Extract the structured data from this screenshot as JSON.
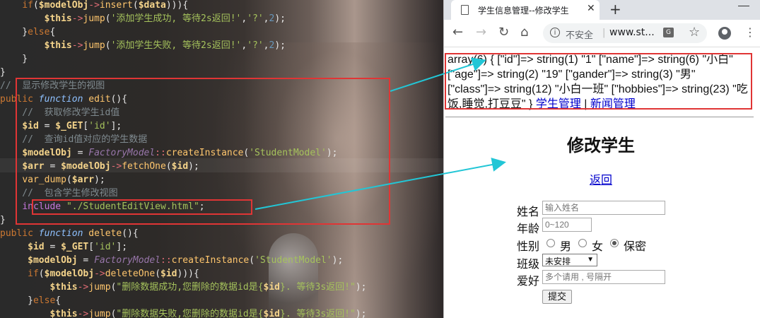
{
  "editor": {
    "lines": [
      {
        "segments": [
          [
            "t-pl",
            "    "
          ],
          [
            "t-kw",
            "if"
          ],
          [
            "t-pl",
            "("
          ],
          [
            "t-var",
            "$modelObj"
          ],
          [
            "t-op",
            "->"
          ],
          [
            "t-fn",
            "insert"
          ],
          [
            "t-pl",
            "("
          ],
          [
            "t-var",
            "$data"
          ],
          [
            "t-pl",
            "))){"
          ]
        ]
      },
      {
        "segments": [
          [
            "t-pl",
            "        "
          ],
          [
            "t-var",
            "$this"
          ],
          [
            "t-op",
            "->"
          ],
          [
            "t-fn",
            "jump"
          ],
          [
            "t-pl",
            "("
          ],
          [
            "t-str",
            "'添加学生成功, 等待2s返回!'"
          ],
          [
            "t-pl",
            ","
          ],
          [
            "t-str",
            "'?'"
          ],
          [
            "t-pl",
            ","
          ],
          [
            "t-num",
            "2"
          ],
          [
            "t-pl",
            ");"
          ]
        ]
      },
      {
        "segments": [
          [
            "t-pl",
            "    }"
          ],
          [
            "t-kw",
            "else"
          ],
          [
            "t-pl",
            "{"
          ]
        ]
      },
      {
        "segments": [
          [
            "t-pl",
            "        "
          ],
          [
            "t-var",
            "$this"
          ],
          [
            "t-op",
            "->"
          ],
          [
            "t-fn",
            "jump"
          ],
          [
            "t-pl",
            "("
          ],
          [
            "t-str",
            "'添加学生失败, 等待2s返回!'"
          ],
          [
            "t-pl",
            ","
          ],
          [
            "t-str",
            "'?'"
          ],
          [
            "t-pl",
            ","
          ],
          [
            "t-num",
            "2"
          ],
          [
            "t-pl",
            ");"
          ]
        ]
      },
      {
        "segments": [
          [
            "t-pl",
            "    }"
          ]
        ]
      },
      {
        "segments": [
          [
            "t-pl",
            "}"
          ]
        ]
      },
      {
        "segments": [
          [
            "t-cm",
            "//  显示修改学生的视图"
          ]
        ]
      },
      {
        "segments": [
          [
            "t-kw",
            "public "
          ],
          [
            "t-it",
            "function "
          ],
          [
            "t-fn",
            "edit"
          ],
          [
            "t-pl",
            "(){"
          ]
        ]
      },
      {
        "segments": [
          [
            "t-cm",
            "    //  获取修改学生id值"
          ]
        ]
      },
      {
        "segments": [
          [
            "t-pl",
            "    "
          ],
          [
            "t-var",
            "$id"
          ],
          [
            "t-pl",
            " = "
          ],
          [
            "t-var",
            "$_GET"
          ],
          [
            "t-pl",
            "["
          ],
          [
            "t-str",
            "'id'"
          ],
          [
            "t-pl",
            "];"
          ]
        ]
      },
      {
        "segments": [
          [
            "t-cm",
            "    //  查询id值对应的学生数据"
          ]
        ]
      },
      {
        "segments": [
          [
            "t-pl",
            "    "
          ],
          [
            "t-var",
            "$modelObj"
          ],
          [
            "t-pl",
            " = "
          ],
          [
            "t-cls",
            "FactoryModel"
          ],
          [
            "t-op",
            "::"
          ],
          [
            "t-fn",
            "createInstance"
          ],
          [
            "t-pl",
            "("
          ],
          [
            "t-str",
            "'StudentModel'"
          ],
          [
            "t-pl",
            ");"
          ]
        ]
      },
      {
        "segments": [
          [
            "t-pl",
            "    "
          ],
          [
            "t-var",
            "$arr"
          ],
          [
            "t-pl",
            " = "
          ],
          [
            "t-var",
            "$modelObj"
          ],
          [
            "t-op",
            "->"
          ],
          [
            "t-fn",
            "fetchOne"
          ],
          [
            "t-pl",
            "("
          ],
          [
            "t-var",
            "$id"
          ],
          [
            "t-pl",
            ");"
          ]
        ]
      },
      {
        "segments": [
          [
            "t-pl",
            "    "
          ],
          [
            "t-fn",
            "var_dump"
          ],
          [
            "t-pl",
            "("
          ],
          [
            "t-var",
            "$arr"
          ],
          [
            "t-pl",
            ");"
          ]
        ]
      },
      {
        "segments": [
          [
            "t-cm",
            "    //  包含学生修改视图"
          ]
        ]
      },
      {
        "segments": [
          [
            "t-pl",
            "    "
          ],
          [
            "t-pur",
            "include"
          ],
          [
            "t-pl",
            " "
          ],
          [
            "t-str",
            "\"./StudentEditView.html\""
          ],
          [
            "t-pl",
            ";"
          ]
        ]
      },
      {
        "segments": [
          [
            "t-pl",
            "}"
          ]
        ]
      },
      {
        "segments": [
          [
            "t-kw",
            "public "
          ],
          [
            "t-it",
            "function "
          ],
          [
            "t-fn",
            "delete"
          ],
          [
            "t-pl",
            "(){"
          ]
        ]
      },
      {
        "segments": [
          [
            "t-pl",
            "     "
          ],
          [
            "t-var",
            "$id"
          ],
          [
            "t-pl",
            " = "
          ],
          [
            "t-var",
            "$_GET"
          ],
          [
            "t-pl",
            "["
          ],
          [
            "t-str",
            "'id'"
          ],
          [
            "t-pl",
            "];"
          ]
        ]
      },
      {
        "segments": [
          [
            "t-pl",
            "     "
          ],
          [
            "t-var",
            "$modelObj"
          ],
          [
            "t-pl",
            " = "
          ],
          [
            "t-cls",
            "FactoryModel"
          ],
          [
            "t-op",
            "::"
          ],
          [
            "t-fn",
            "createInstance"
          ],
          [
            "t-pl",
            "("
          ],
          [
            "t-str",
            "'StudentModel'"
          ],
          [
            "t-pl",
            ");"
          ]
        ]
      },
      {
        "segments": [
          [
            "t-pl",
            "     "
          ],
          [
            "t-kw",
            "if"
          ],
          [
            "t-pl",
            "("
          ],
          [
            "t-var",
            "$modelObj"
          ],
          [
            "t-op",
            "->"
          ],
          [
            "t-fn",
            "deleteOne"
          ],
          [
            "t-pl",
            "("
          ],
          [
            "t-var",
            "$id"
          ],
          [
            "t-pl",
            "))){"
          ]
        ]
      },
      {
        "segments": [
          [
            "t-pl",
            "         "
          ],
          [
            "t-var",
            "$this"
          ],
          [
            "t-op",
            "->"
          ],
          [
            "t-fn",
            "jump"
          ],
          [
            "t-pl",
            "("
          ],
          [
            "t-str",
            "\"删除数据成功,您删除的数据id是{"
          ],
          [
            "t-var",
            "$id"
          ],
          [
            "t-str",
            "}. 等待3s返回!\""
          ],
          [
            "t-pl",
            ");"
          ]
        ]
      },
      {
        "segments": [
          [
            "t-pl",
            "     }"
          ],
          [
            "t-kw",
            "else"
          ],
          [
            "t-pl",
            "{"
          ]
        ]
      },
      {
        "segments": [
          [
            "t-pl",
            "         "
          ],
          [
            "t-var",
            "$this"
          ],
          [
            "t-op",
            "->"
          ],
          [
            "t-fn",
            "jump"
          ],
          [
            "t-pl",
            "("
          ],
          [
            "t-str",
            "\"删除数据失败,您删除的数据id是{"
          ],
          [
            "t-var",
            "$id"
          ],
          [
            "t-str",
            "}. 等待3s返回!\""
          ],
          [
            "t-pl",
            ");"
          ]
        ]
      }
    ]
  },
  "browser": {
    "tab_title": "学生信息管理--修改学生",
    "tab_close": "✕",
    "new_tab": "+",
    "nav": {
      "back": "←",
      "forward": "→",
      "reload": "↻",
      "home": "⌂",
      "menu": "⋮"
    },
    "omnibox": {
      "info": "i",
      "security": "不安全",
      "separator": "|",
      "url": "www.st...",
      "translate": "G",
      "star": "☆"
    },
    "icons": {
      "doc": "page-icon",
      "account": "account-icon"
    }
  },
  "page": {
    "dump_text": "array(6) { [\"id\"]=> string(1) \"1\" [\"name\"]=> string(6) \"小白\" [\"age\"]=> string(2) \"19\" [\"gander\"]=> string(3) \"男\" [\"class\"]=> string(12) \"小白一班\" [\"hobbies\"]=> string(23) \"吃饭,睡觉,打豆豆\" } ",
    "nav_link1": "学生管理",
    "nav_sep": " | ",
    "nav_link2": "新闻管理",
    "heading": "修改学生",
    "back_link": "返回",
    "form": {
      "name_label": "姓名",
      "name_placeholder": "输入姓名",
      "age_label": "年龄",
      "age_placeholder": "0~120",
      "gender_label": "性别",
      "gender_male": "男",
      "gender_female": "女",
      "gender_secret": "保密",
      "class_label": "班级",
      "class_value": "未安排",
      "class_arrow": "▼",
      "hobby_label": "爱好",
      "hobby_placeholder": "多个请用 , 号隔开",
      "submit": "提交"
    }
  },
  "colors": {
    "highlight_box": "#e03535",
    "arrow": "#22c6d6"
  }
}
